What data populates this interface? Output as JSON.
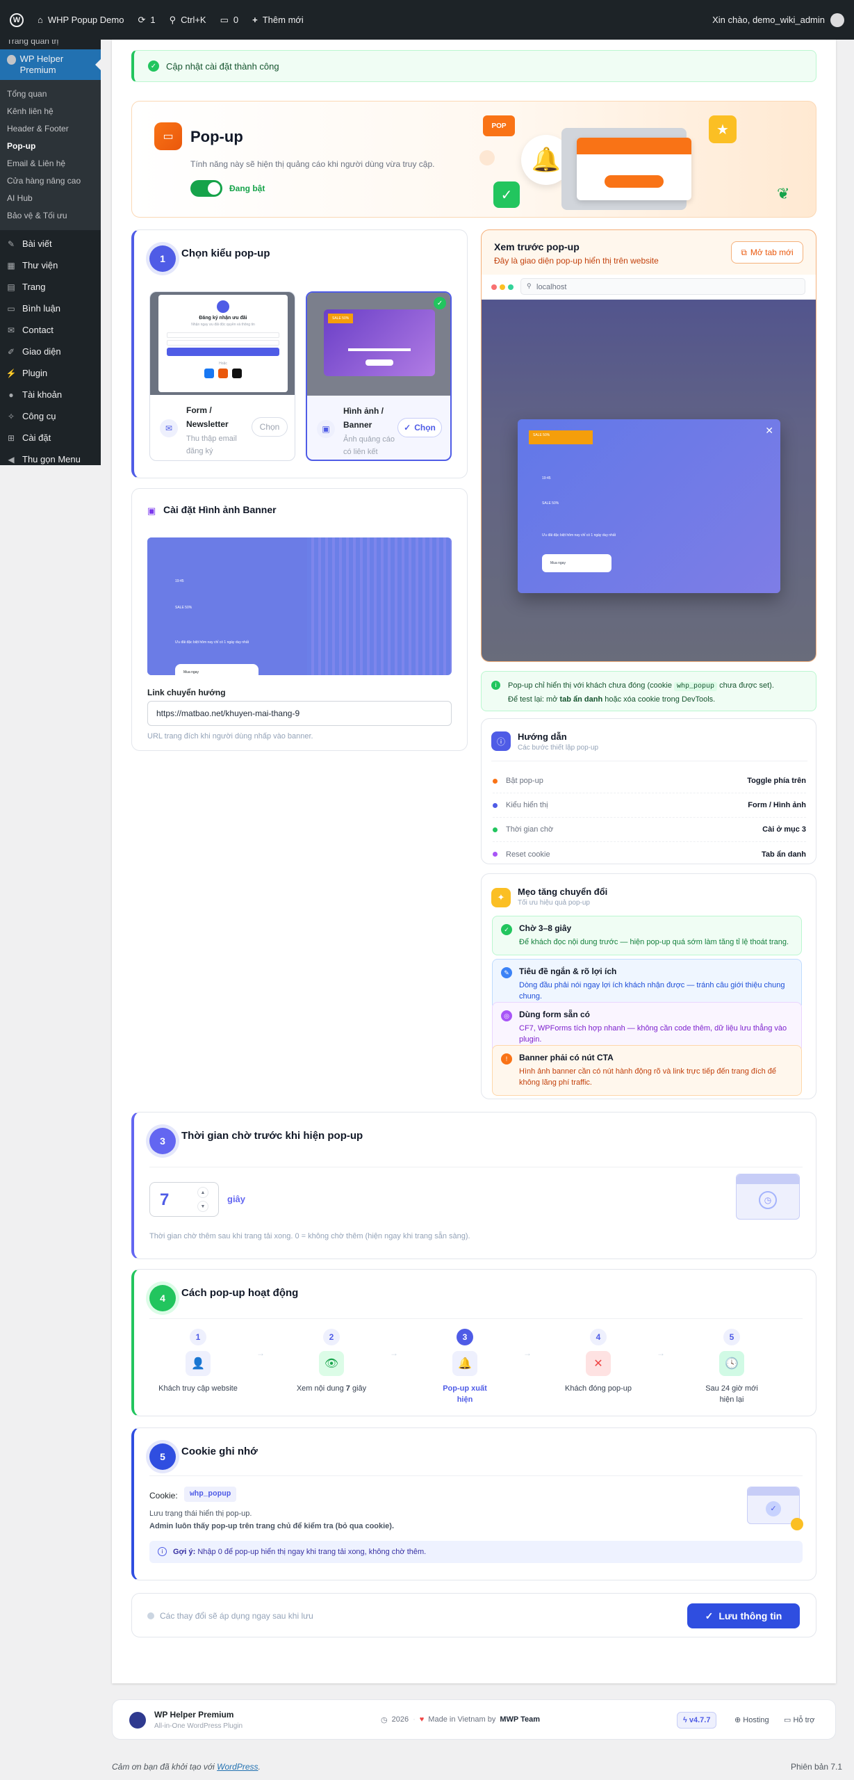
{
  "adminbar": {
    "site": "WHP Popup Demo",
    "updates": "1",
    "search": "Ctrl+K",
    "comments": "0",
    "new": "Thêm mới",
    "greeting": "Xin chào, demo_wiki_admin"
  },
  "sidebar": {
    "cut_item": "Trang quản trị",
    "current": "WP Helper Premium",
    "submenu": [
      "Tổng quan",
      "Kênh liên hệ",
      "Header & Footer",
      "Pop-up",
      "Email & Liên hệ",
      "Cửa hàng nâng cao",
      "AI Hub",
      "Bảo vệ & Tối ưu"
    ],
    "menu": [
      {
        "label": "Bài viết",
        "icon": "pin-icon"
      },
      {
        "label": "Thư viện",
        "icon": "media-icon"
      },
      {
        "label": "Trang",
        "icon": "page-icon"
      },
      {
        "label": "Bình luận",
        "icon": "comment-icon"
      },
      {
        "label": "Contact",
        "icon": "mail-icon"
      },
      {
        "label": "Giao diện",
        "icon": "brush-icon"
      },
      {
        "label": "Plugin",
        "icon": "plugin-icon"
      },
      {
        "label": "Tài khoản",
        "icon": "user-icon"
      },
      {
        "label": "Công cụ",
        "icon": "wrench-icon"
      },
      {
        "label": "Cài đặt",
        "icon": "settings-icon"
      },
      {
        "label": "Thu gọn Menu",
        "icon": "collapse-icon"
      }
    ]
  },
  "notice": "Cập nhật cài đặt thành công",
  "hero": {
    "title": "Pop-up",
    "desc": "Tính năng này sẽ hiện thị quảng cáo khi người dùng vừa truy cập.",
    "toggle": "Đang bật",
    "badge": "POP"
  },
  "section1": {
    "num": "1",
    "title": "Chọn kiểu pop-up",
    "form": {
      "title": "Form / Newsletter",
      "desc": "Thu thập email đăng ký",
      "btn": "Chọn",
      "thumb_title": "Đăng ký nhận ưu đãi",
      "thumb_sub": "Nhận ngay ưu đãi độc quyền và thông tin",
      "thumb_or": "Hoặc"
    },
    "banner": {
      "title": "Hình ảnh / Banner",
      "desc": "Ảnh quảng cáo có liên kết",
      "btn": "Chọn",
      "thumb_tag": "SALE 50%"
    }
  },
  "banner_settings": {
    "title": "Cài đặt Hình ảnh Banner",
    "preview_lines": [
      "19:45",
      "SALE 50%",
      "Ưu đãi đặc biệt hôm nay chỉ có 1 ngày duy nhất"
    ],
    "preview_btn": "Mua ngay",
    "link_label": "Link chuyển hướng",
    "link_value": "https://matbao.net/khuyen-mai-thang-9",
    "link_hint": "URL trang đích khi người dùng nhấp vào banner."
  },
  "preview": {
    "title": "Xem trước pop-up",
    "sub": "Đây là giao diện pop-up hiển thị trên website",
    "open_btn": "Mở tab mới",
    "url": "localhost",
    "popup_tag": "SALE 50%",
    "popup_lines": [
      "19:45",
      "SALE 50%",
      "Ưu đãi đặc biệt hôm nay chỉ có 1 ngày duy nhất"
    ],
    "popup_btn": "Mua ngay"
  },
  "info": {
    "text1_a": "Pop-up chỉ hiển thị với khách chưa đóng (cookie ",
    "code": "whp_popup",
    "text1_b": " chưa được set).",
    "text2_a": "Để test lại: mở ",
    "text2_bold": "tab ẩn danh",
    "text2_b": " hoặc xóa cookie trong DevTools."
  },
  "guide": {
    "title": "Hướng dẫn",
    "sub": "Các bước thiết lập pop-up",
    "rows": [
      {
        "label": "Bật pop-up",
        "value": "Toggle phía trên",
        "color": "#f97316"
      },
      {
        "label": "Kiểu hiển thị",
        "value": "Form / Hình ảnh",
        "color": "#4f5ce6"
      },
      {
        "label": "Thời gian chờ",
        "value": "Cài ở mục 3",
        "color": "#22c55e"
      },
      {
        "label": "Reset cookie",
        "value": "Tab ẩn danh",
        "color": "#a855f7"
      }
    ]
  },
  "tips": {
    "title": "Mẹo tăng chuyển đổi",
    "sub": "Tối ưu hiệu quả pop-up",
    "items": [
      {
        "title": "Chờ 3–8 giây",
        "desc": "Để khách đọc nội dung trước — hiện pop-up quá sớm làm tăng tỉ lệ thoát trang.",
        "bg": "#f0fdf4",
        "bd": "#bbf7d0",
        "fg": "#15803d",
        "ic": "#22c55e",
        "sym": "✓"
      },
      {
        "title": "Tiêu đề ngắn & rõ lợi ích",
        "desc": "Dòng đầu phải nói ngay lợi ích khách nhận được — tránh câu giới thiệu chung chung.",
        "bg": "#eff6ff",
        "bd": "#bfdbfe",
        "fg": "#1d4ed8",
        "ic": "#3b82f6",
        "sym": "✎"
      },
      {
        "title": "Dùng form sẵn có",
        "desc": "CF7, WPForms tích hợp nhanh — không cần code thêm, dữ liệu lưu thẳng vào plugin.",
        "bg": "#faf5ff",
        "bd": "#e9d5ff",
        "fg": "#7e22ce",
        "ic": "#a855f7",
        "sym": "◎"
      },
      {
        "title": "Banner phải có nút CTA",
        "desc": "Hình ảnh banner cần có nút hành động rõ và link trực tiếp đến trang đích để không lãng phí traffic.",
        "bg": "#fff7ed",
        "bd": "#fed7aa",
        "fg": "#c2410c",
        "ic": "#f97316",
        "sym": "!"
      }
    ]
  },
  "section3": {
    "num": "3",
    "title": "Thời gian chờ trước khi hiện pop-up",
    "value": "7",
    "unit": "giây",
    "hint": "Thời gian chờ thêm sau khi trang tải xong. 0 = không chờ thêm (hiện ngay khi trang sẵn sàng)."
  },
  "section4": {
    "num": "4",
    "title": "Cách pop-up hoạt động",
    "steps": [
      {
        "n": "1",
        "text": "Khách truy cập website",
        "ic": "#eef0fd",
        "fg": "#6366f1",
        "sym": "👤"
      },
      {
        "n": "2",
        "text": "Xem nội dung 7 giây",
        "ic": "#dcfce7",
        "fg": "#16a34a",
        "sym": "👁"
      },
      {
        "n": "3",
        "text": "Pop-up xuất hiện",
        "ic": "#eef0fd",
        "fg": "#4f5ce6",
        "sym": "🔔"
      },
      {
        "n": "4",
        "text": "Khách đóng pop-up",
        "ic": "#fee2e2",
        "fg": "#ef4444",
        "sym": "✕"
      },
      {
        "n": "5",
        "text": "Sau 24 giờ mới hiện lại",
        "ic": "#d1fae5",
        "fg": "#059669",
        "sym": "🕓"
      }
    ]
  },
  "section5": {
    "num": "5",
    "title": "Cookie ghi nhớ",
    "cookie_label": "Cookie:",
    "cookie": "whp_popup",
    "line1": "Lưu trạng thái hiển thị pop-up.",
    "line2": "Admin luôn thấy pop-up trên trang chủ để kiểm tra (bỏ qua cookie).",
    "hint_bold": "Gợi ý:",
    "hint": " Nhập 0 để pop-up hiển thị ngay khi trang tải xong, không chờ thêm."
  },
  "save": {
    "note": "Các thay đổi sẽ áp dụng ngay sau khi lưu",
    "btn": "Lưu thông tin"
  },
  "footer": {
    "name": "WP Helper Premium",
    "sub": "All-in-One WordPress Plugin",
    "year": "2026",
    "made": "Made in Vietnam by",
    "team": "MWP Team",
    "version": "v4.7.7",
    "hosting": "Hosting",
    "support": "Hỗ trợ"
  },
  "wpfooter": {
    "thanks": "Cảm ơn bạn đã khởi tạo với ",
    "link": "WordPress",
    "dot": ".",
    "version": "Phiên bản 7.1"
  }
}
